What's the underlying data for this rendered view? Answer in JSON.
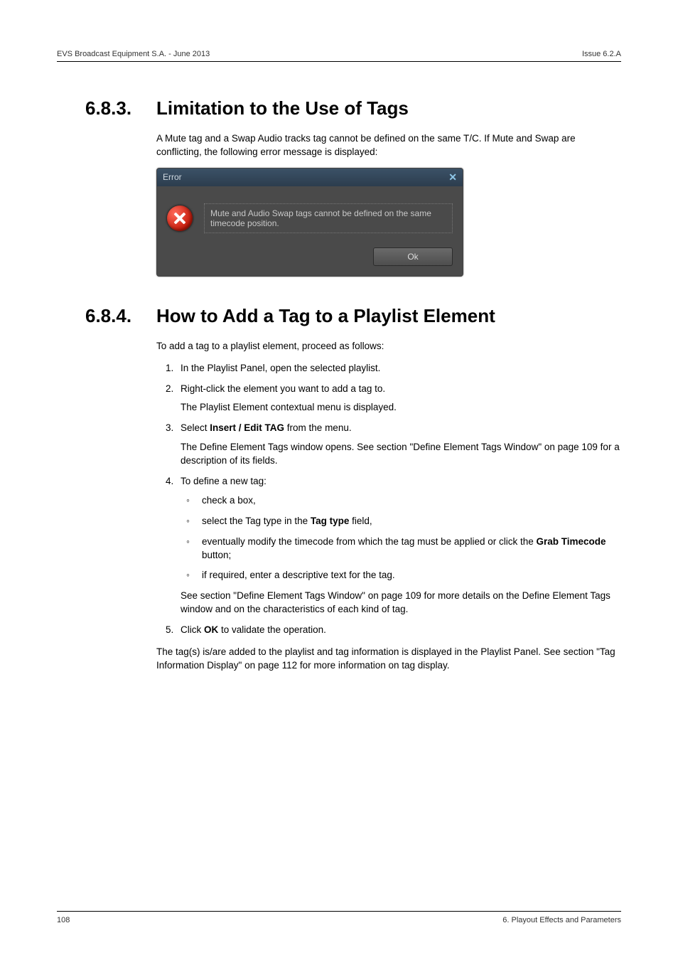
{
  "header": {
    "left": "EVS Broadcast Equipment S.A. - June 2013",
    "right": "Issue 6.2.A"
  },
  "section_683": {
    "num": "6.8.3.",
    "title": "Limitation to the Use of Tags",
    "intro": "A Mute tag and a Swap Audio tracks tag cannot be defined on the same T/C. If Mute and Swap are conflicting, the following error message is displayed:"
  },
  "dialog": {
    "title": "Error",
    "close_glyph": "✕",
    "message": "Mute and Audio Swap tags cannot be defined on the same timecode position.",
    "ok_label": "Ok"
  },
  "section_684": {
    "num": "6.8.4.",
    "title": "How to Add a Tag to a Playlist Element",
    "intro": "To add a tag to a playlist element, proceed as follows:",
    "steps": {
      "s1": "In the Playlist Panel, open the selected playlist.",
      "s2": "Right-click the element you want to add a tag to.",
      "s2_sub": "The Playlist Element contextual menu is displayed.",
      "s3_pre": "Select ",
      "s3_bold": "Insert / Edit TAG",
      "s3_post": " from the menu.",
      "s3_sub": "The Define Element Tags window opens. See section \"Define Element Tags Window\" on page 109 for a description of its fields.",
      "s4": "To define a new tag:",
      "s4_a": "check a box,",
      "s4_b_pre": "select the Tag type in the ",
      "s4_b_bold": "Tag type",
      "s4_b_post": " field,",
      "s4_c_pre": "eventually modify the timecode from which the tag must be applied or click the ",
      "s4_c_bold": "Grab Timecode",
      "s4_c_post": " button;",
      "s4_d": "if required, enter a descriptive text for the tag.",
      "s4_sub": "See section \"Define Element Tags Window\" on page 109 for more details on the Define Element Tags window and on the characteristics of each kind of tag.",
      "s5_pre": "Click ",
      "s5_bold": "OK",
      "s5_post": " to validate the operation."
    },
    "closing": "The tag(s) is/are added to the playlist and tag information is displayed in the Playlist Panel. See section \"Tag Information Display\" on page 112 for more information on tag display."
  },
  "footer": {
    "left": "108",
    "right": "6. Playout Effects and Parameters"
  }
}
